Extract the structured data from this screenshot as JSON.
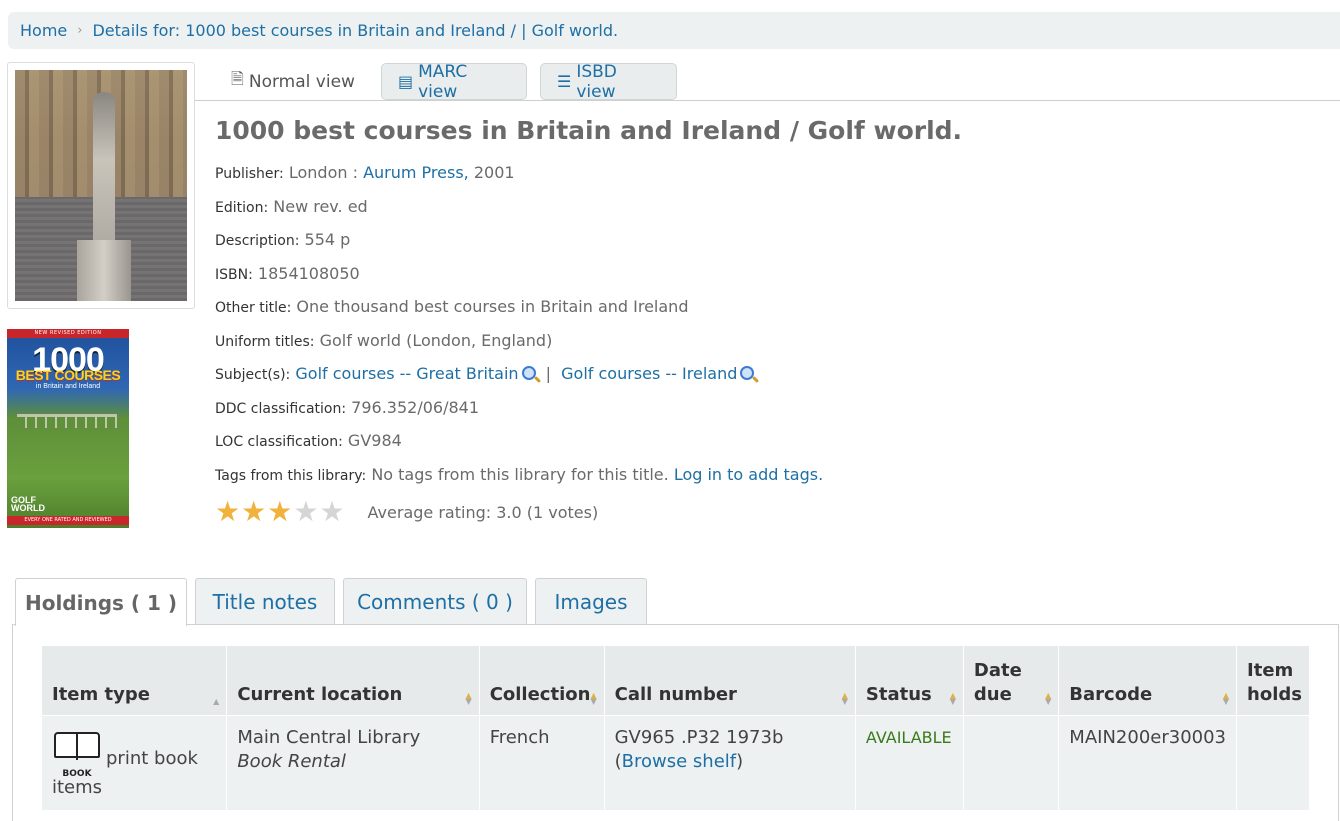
{
  "breadcrumb": {
    "home": "Home",
    "details": "Details for: 1000 best courses in Britain and Ireland / | Golf world."
  },
  "views": {
    "normal": "Normal view",
    "marc": "MARC view",
    "isbd": "ISBD view"
  },
  "record": {
    "title": "1000 best courses in Britain and Ireland / Golf world.",
    "publisher_label": "Publisher:",
    "publisher_place": "London :",
    "publisher_name": "Aurum Press,",
    "publisher_year": "2001",
    "edition_label": "Edition:",
    "edition": "New rev. ed",
    "description_label": "Description:",
    "description": "554 p",
    "isbn_label": "ISBN:",
    "isbn": "1854108050",
    "other_title_label": "Other title:",
    "other_title": "One thousand best courses in Britain and Ireland",
    "uniform_label": "Uniform titles:",
    "uniform": "Golf world (London, England)",
    "subjects_label": "Subject(s):",
    "subject_1": "Golf courses -- Great Britain",
    "subject_sep": "|",
    "subject_2": "Golf courses -- Ireland",
    "ddc_label": "DDC classification:",
    "ddc": "796.352/06/841",
    "loc_label": "LOC classification:",
    "loc": "GV984",
    "tags_label": "Tags from this library:",
    "tags_text": "No tags from this library for this title.",
    "tags_login": "Log in to add tags.",
    "rating_value": 3,
    "rating_max": 5,
    "rating_text": "Average rating: 3.0 (1 votes)"
  },
  "covers": {
    "book_top": "NEW REVISED EDITION",
    "book_big": "1000",
    "book_mid": "BEST COURSES",
    "book_sub": "in Britain and Ireland",
    "book_logo_1": "GOLF",
    "book_logo_2": "WORLD",
    "book_bottom": "EVERY ONE RATED AND REVIEWED"
  },
  "tabs": {
    "holdings": "Holdings ( 1 )",
    "title_notes": "Title notes",
    "comments": "Comments ( 0 )",
    "images": "Images"
  },
  "holdings": {
    "headers": {
      "item_type": "Item type",
      "location": "Current location",
      "collection": "Collection",
      "call_number": "Call number",
      "status": "Status",
      "date_due": "Date due",
      "barcode": "Barcode",
      "item_holds": "Item holds"
    },
    "rows": [
      {
        "item_type_icon_text": "BOOK",
        "item_type": "print book items",
        "location_main": "Main Central Library",
        "location_sub": "Book Rental",
        "collection": "French",
        "call_number": "GV965 .P32 1973b",
        "browse_open": "(",
        "browse_link": "Browse shelf",
        "browse_close": ")",
        "status": "AVAILABLE",
        "date_due": "",
        "barcode": "MAIN200er30003",
        "item_holds": ""
      }
    ]
  }
}
